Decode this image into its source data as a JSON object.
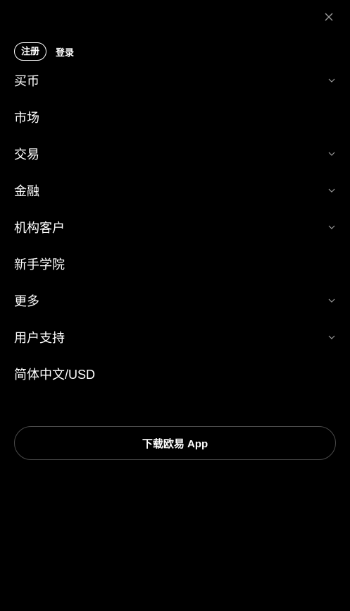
{
  "header": {
    "close_icon": "close-icon"
  },
  "auth": {
    "register_label": "注册",
    "login_label": "登录"
  },
  "menu": {
    "items": [
      {
        "label": "买币",
        "has_submenu": true
      },
      {
        "label": "市场",
        "has_submenu": false
      },
      {
        "label": "交易",
        "has_submenu": true
      },
      {
        "label": "金融",
        "has_submenu": true
      },
      {
        "label": "机构客户",
        "has_submenu": true
      },
      {
        "label": "新手学院",
        "has_submenu": false
      },
      {
        "label": "更多",
        "has_submenu": true
      },
      {
        "label": "用户支持",
        "has_submenu": true
      },
      {
        "label": "简体中文/USD",
        "has_submenu": false
      }
    ]
  },
  "download": {
    "label": "下载欧易 App"
  },
  "colors": {
    "background": "#000000",
    "text": "#ffffff",
    "muted_icon": "#9a9a9a",
    "border": "#4a4a4a"
  }
}
